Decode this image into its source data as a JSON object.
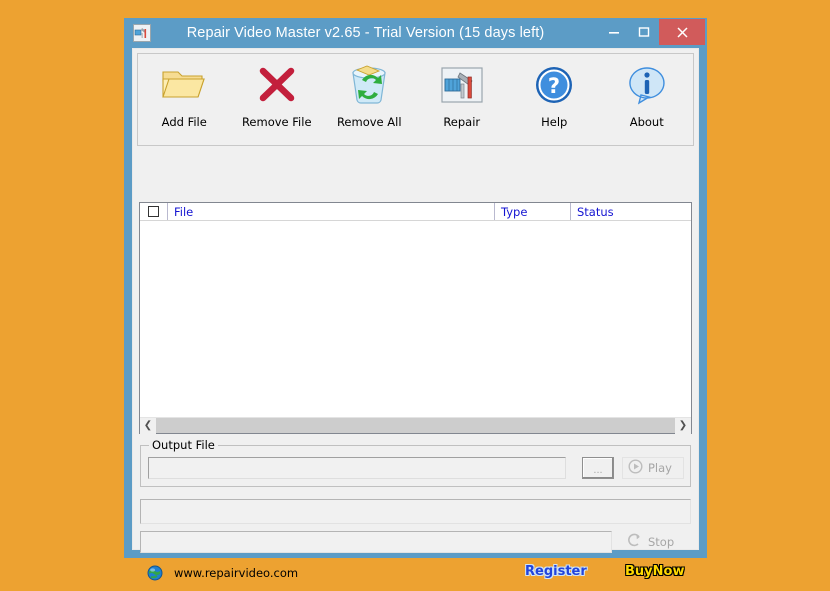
{
  "desktop": {
    "background_color": "#eda231"
  },
  "window": {
    "frame_color": "#5c9cc6",
    "title": "Repair Video Master v2.65 - Trial Version (15 days left)",
    "icon": "repair-tool-icon",
    "caption": {
      "minimize": "minimize-icon",
      "maximize": "maximize-icon",
      "close": "close-icon",
      "close_color": "#d15b5b"
    }
  },
  "toolbar": {
    "buttons": [
      {
        "label": "Add File",
        "icon": "open-folder-icon"
      },
      {
        "label": "Remove File",
        "icon": "red-cross-icon"
      },
      {
        "label": "Remove All",
        "icon": "recycle-bin-icon"
      },
      {
        "label": "Repair",
        "icon": "repair-tool-icon"
      },
      {
        "label": "Help",
        "icon": "question-mark-icon"
      },
      {
        "label": "About",
        "icon": "info-icon"
      }
    ]
  },
  "file_list": {
    "header_color": "#1414d2",
    "select_all_checkbox": "unchecked",
    "columns": [
      {
        "label": "File"
      },
      {
        "label": "Type"
      },
      {
        "label": "Status"
      }
    ],
    "rows": [],
    "scrollbar": {
      "left_arrow": "chevron-left-icon",
      "right_arrow": "chevron-right-icon"
    }
  },
  "output_file": {
    "legend": "Output File",
    "path_value": "",
    "path_placeholder": "",
    "browse_label": "...",
    "play_label": "Play",
    "play_icon": "play-circle-icon",
    "play_enabled": false
  },
  "status": {
    "message": "",
    "progress_percent": 0,
    "stop_label": "Stop",
    "stop_icon": "stop-circle-icon",
    "stop_enabled": false
  },
  "footer": {
    "globe_icon": "globe-icon",
    "url": "www.repairvideo.com",
    "register_label": "Register",
    "register_color": "#2244dd",
    "buynow_label": "BuyNow",
    "buynow_color": "#ffd900"
  }
}
